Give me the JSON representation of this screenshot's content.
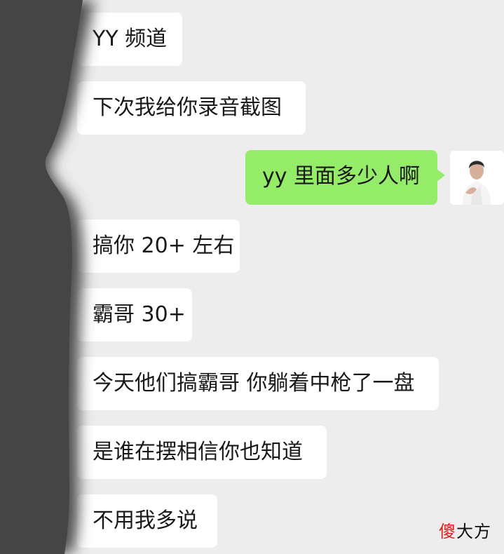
{
  "chat": {
    "messages": [
      {
        "side": "in",
        "text": "YY 频道"
      },
      {
        "side": "in",
        "text": "下次我给你录音截图"
      },
      {
        "side": "out",
        "text": "yy 里面多少人啊"
      },
      {
        "side": "in",
        "text": "搞你 20+ 左右"
      },
      {
        "side": "in",
        "text": "霸哥 30+"
      },
      {
        "side": "in",
        "text": "今天他们搞霸哥 你躺着中枪了一盘"
      },
      {
        "side": "in",
        "text": "是谁在摆相信你也知道"
      },
      {
        "side": "in",
        "text": "不用我多说"
      }
    ]
  },
  "watermark": {
    "first": "傻",
    "rest": "大方"
  },
  "colors": {
    "background": "#ededed",
    "incoming_bubble": "#ffffff",
    "outgoing_bubble": "#95ec69",
    "watermark_accent": "#e11d1d"
  }
}
